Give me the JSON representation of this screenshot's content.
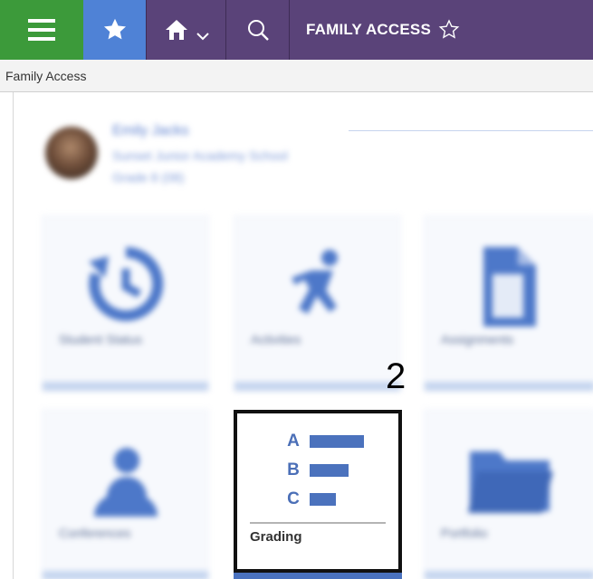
{
  "topbar": {
    "menu_icon": "hamburger-menu-icon",
    "favorites_icon": "star-icon",
    "home_icon": "home-icon",
    "home_dropdown_icon": "chevron-down-icon",
    "search_icon": "search-icon",
    "title": "FAMILY ACCESS",
    "title_favorite_icon": "star-outline-icon",
    "colors": {
      "bar": "#5a4379",
      "menu": "#3c9a3a",
      "favorites": "#4f82d6"
    }
  },
  "breadcrumb": {
    "text": "Family Access"
  },
  "student": {
    "name": "Emily Jacks",
    "line1": "Sunset Junior Academy School",
    "line2": "Grade 8 (08)"
  },
  "tiles": [
    {
      "label": "Student Status",
      "icon": "history-icon"
    },
    {
      "label": "Activities",
      "icon": "running-person-icon"
    },
    {
      "label": "Assignments",
      "icon": "document-icon"
    },
    {
      "label": "Conferences",
      "icon": "people-icon"
    },
    {
      "label": "Grading",
      "icon": "grading-bars-icon"
    },
    {
      "label": "Portfolio",
      "icon": "folder-icon"
    }
  ],
  "grading": {
    "rows": [
      {
        "letter": "A",
        "bar_fraction": 1.0
      },
      {
        "letter": "B",
        "bar_fraction": 0.72
      },
      {
        "letter": "C",
        "bar_fraction": 0.48
      }
    ]
  },
  "annotation": {
    "step": "2"
  }
}
